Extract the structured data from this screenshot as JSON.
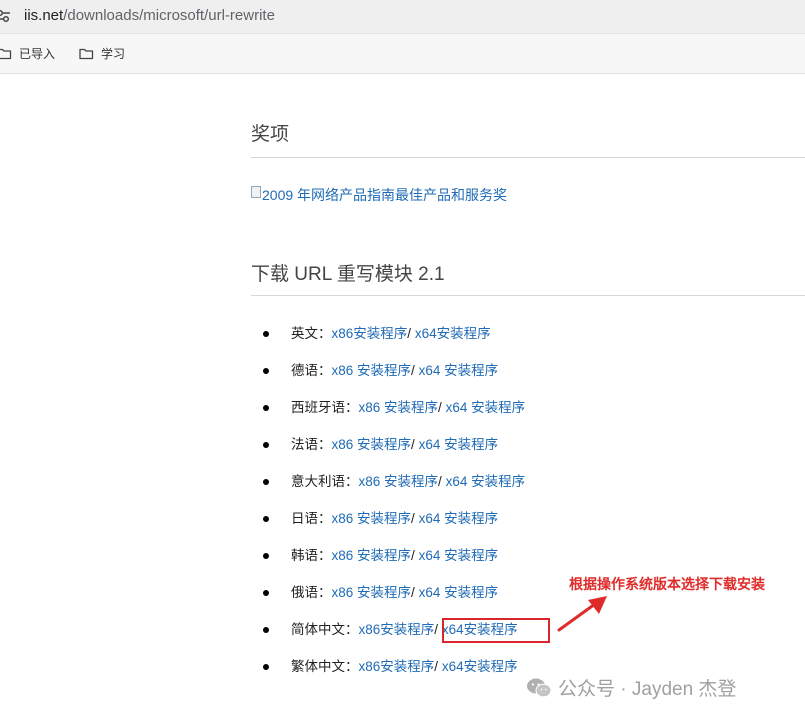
{
  "browser": {
    "url_host": "iis.net",
    "url_path": "/downloads/microsoft/url-rewrite",
    "bookmarks": [
      {
        "label": "已导入",
        "icon": "folder-icon"
      },
      {
        "label": "学习",
        "icon": "folder-icon"
      }
    ]
  },
  "awards": {
    "title": "奖项",
    "award_link": "2009 年网络产品指南最佳产品和服务奖"
  },
  "download": {
    "title": "下载 URL 重写模块 2.1",
    "separator": "/",
    "items": [
      {
        "lang": "英文：",
        "x86": "x86安装程序",
        "x64": "x64安装程序"
      },
      {
        "lang": "德语：",
        "x86": "x86 安装程序",
        "x64": "x64 安装程序"
      },
      {
        "lang": "西班牙语：",
        "x86": "x86 安装程序",
        "x64": "x64 安装程序"
      },
      {
        "lang": "法语：",
        "x86": "x86 安装程序",
        "x64": "x64 安装程序"
      },
      {
        "lang": "意大利语：",
        "x86": "x86 安装程序",
        "x64": "x64 安装程序"
      },
      {
        "lang": "日语：",
        "x86": "x86 安装程序",
        "x64": "x64 安装程序"
      },
      {
        "lang": "韩语：",
        "x86": "x86 安装程序",
        "x64": "x64 安装程序"
      },
      {
        "lang": "俄语：",
        "x86": "x86 安装程序",
        "x64": "x64 安装程序"
      },
      {
        "lang": "简体中文：",
        "x86": "x86安装程序",
        "x64": "x64安装程序"
      },
      {
        "lang": "繁体中文：",
        "x86": "x86安装程序",
        "x64": "x64安装程序"
      }
    ]
  },
  "annotation": {
    "text": "根据操作系统版本选择下载安装",
    "color": "#e02b2b"
  },
  "watermark": {
    "text": "公众号 · Jayden 杰登",
    "icon": "wechat-icon"
  },
  "colors": {
    "link": "#1f6bb5",
    "highlight": "#d9262c"
  }
}
